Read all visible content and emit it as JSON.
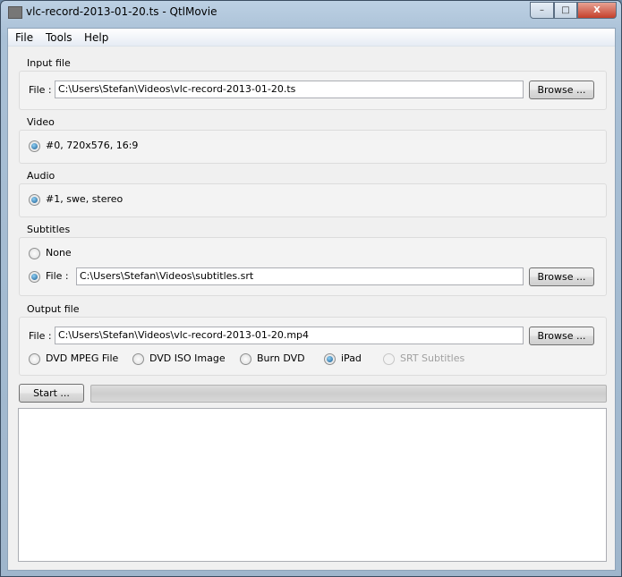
{
  "window": {
    "title": "vlc-record-2013-01-20.ts - QtlMovie",
    "minimize": "–",
    "maximize": "□",
    "close": "X"
  },
  "menu": [
    "File",
    "Tools",
    "Help"
  ],
  "input": {
    "group": "Input file",
    "file_label": "File :",
    "path": "C:\\Users\\Stefan\\Videos\\vlc-record-2013-01-20.ts",
    "browse": "Browse ..."
  },
  "video": {
    "group": "Video",
    "option": "#0, 720x576, 16:9"
  },
  "audio": {
    "group": "Audio",
    "option": "#1, swe, stereo"
  },
  "subtitles": {
    "group": "Subtitles",
    "none": "None",
    "file_label": "File :",
    "path": "C:\\Users\\Stefan\\Videos\\subtitles.srt",
    "browse": "Browse ..."
  },
  "output": {
    "group": "Output file",
    "file_label": "File :",
    "path": "C:\\Users\\Stefan\\Videos\\vlc-record-2013-01-20.mp4",
    "browse": "Browse ...",
    "types": [
      "DVD MPEG File",
      "DVD ISO Image",
      "Burn DVD",
      "iPad",
      "SRT Subtitles"
    ],
    "selected": "iPad"
  },
  "start": "Start ...",
  "progress": 0
}
